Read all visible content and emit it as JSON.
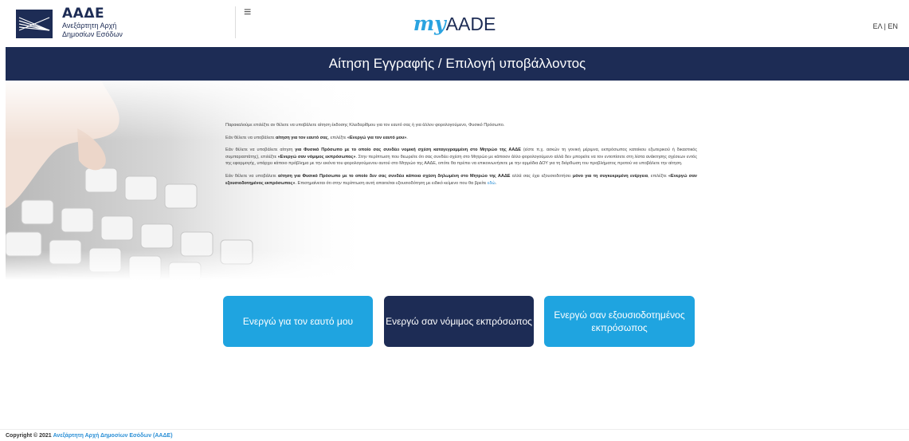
{
  "header": {
    "logo_title": "ΑΑΔΕ",
    "logo_sub1": "Ανεξάρτητη Αρχή",
    "logo_sub2": "Δημοσίων Εσόδων",
    "menu_glyph": "≡",
    "brand_my": "my",
    "brand_aade": "AADE",
    "lang_el": "ΕΛ",
    "lang_sep": " | ",
    "lang_en": "EN"
  },
  "title": "Αίτηση Εγγραφής / Επιλογή υποβάλλοντος",
  "content": {
    "p1": "Παρακαλούμε επιλέξτε αν θέλετε να υποβάλετε αίτηση έκδοσης Κλειδαρίθμου για τον εαυτό σας ή για άλλον φορολογούμενο, Φυσικό Πρόσωπο.",
    "p2_a": "Εάν θέλετε να υποβάλετε ",
    "p2_b": "αίτηση για τον εαυτό σας",
    "p2_c": ", επιλέξτε ",
    "p2_d": "«Ενεργώ για τον εαυτό μου»",
    "p2_e": ".",
    "p3_a": "Εάν θέλετε να υποβάλετε αίτηση ",
    "p3_b": "για Φυσικό Πρόσωπο με το οποίο σας συνδέει νομική σχέση καταγεγραμμένη στο Μητρώο της ΑΑΔΕ",
    "p3_c": " (είστε π.χ. ασκών τη γονική μέριμνα, εκπρόσωπος κατοίκου εξωτερικού ή δικαστικός συμπαραστάτης), επιλέξτε ",
    "p3_d": "«Ενεργώ σαν νόμιμος εκπρόσωπος»",
    "p3_e": ". Στην περίπτωση που θεωρείτε ότι σας συνδέει σχέση στο Μητρώο με κάποιον άλλο φορολογούμενο αλλά δεν μπορείτε να τον εντοπίσετε στη λίστα ανάκτησης σχέσεων εντός της εφαρμογής, υπάρχει κάποιο πρόβλημα με την εικόνα του φορολογούμενου αυτού στο Μητρώο της ΑΑΔΕ, οπότε θα πρέπει να επικοινωνήσετε με την αρμόδια ΔΟΥ για τη διόρθωση του προβλήματος προτού να υποβάλετε την αίτηση.",
    "p4_a": "Εάν θέλετε να υποβάλετε ",
    "p4_b": "αίτηση για Φυσικό Πρόσωπο με το οποίο δεν σας συνδέει κάποια σχέση δηλωμένη στο Μητρώο της ΑΑΔΕ",
    "p4_c": " αλλά σας έχει εξουσιοδοτήσει ",
    "p4_d": "μόνο για τη συγκεκριμένη ενέργεια",
    "p4_e": ", επιλέξτε ",
    "p4_f": "«Ενεργώ σαν εξουσιοδοτημένος εκπρόσωπος»",
    "p4_g": ". Επισημαίνεται ότι στην περίπτωση αυτή απαιτείται εξουσιοδότηση με ειδικό κείμενο που θα βρείτε ",
    "p4_link": "εδώ",
    "p4_h": "."
  },
  "buttons": {
    "self": "Ενεργώ για τον εαυτό μου",
    "legal": "Ενεργώ σαν νόμιμος εκπρόσωπος",
    "authorized": "Ενεργώ σαν εξουσιοδοτημένος εκπρόσωπος"
  },
  "footer": {
    "copyright": "Copyright © 2021 ",
    "link": "Ανεξάρτητη Αρχή Δημοσίων Εσόδων (ΑΑΔΕ)"
  },
  "colors": {
    "navy": "#1d2c55",
    "accent": "#1fa4e0"
  }
}
